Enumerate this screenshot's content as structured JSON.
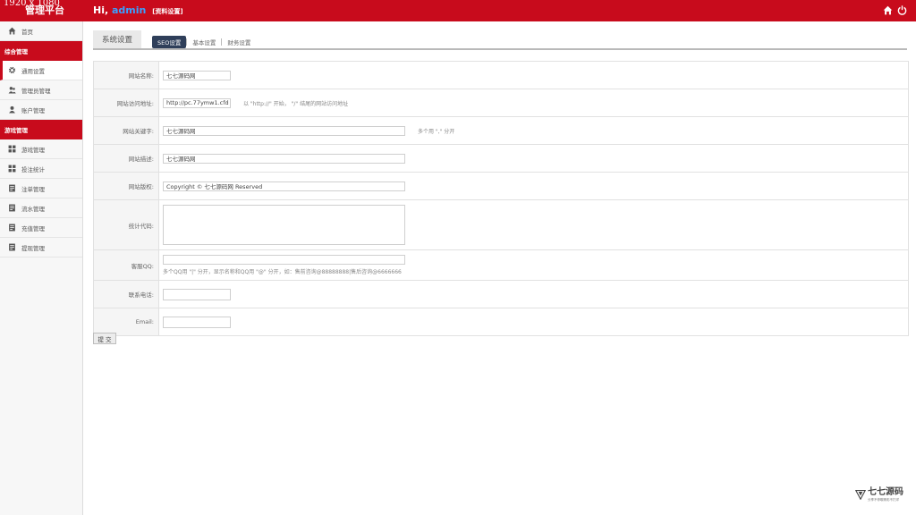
{
  "header": {
    "resolution_text": "1920 x 1080",
    "brand": "管理平台",
    "greeting": "Hi,",
    "username": "admin",
    "profile_link": "[资料设置]",
    "bg_color": "#c80b1c",
    "icons": [
      "home-icon",
      "power-icon"
    ]
  },
  "sidebar": {
    "items": [
      {
        "type": "item",
        "label": "首页",
        "icon": "home-icon",
        "active": false
      },
      {
        "type": "group",
        "label": "综合管理"
      },
      {
        "type": "item",
        "label": "通用设置",
        "icon": "gear-icon",
        "active": true
      },
      {
        "type": "item",
        "label": "管理员管理",
        "icon": "users-icon",
        "active": false
      },
      {
        "type": "item",
        "label": "账户管理",
        "icon": "user-icon",
        "active": false
      },
      {
        "type": "group",
        "label": "游戏管理"
      },
      {
        "type": "item",
        "label": "游戏管理",
        "icon": "grid-icon",
        "active": false
      },
      {
        "type": "item",
        "label": "投注统计",
        "icon": "grid-icon",
        "active": false
      },
      {
        "type": "item",
        "label": "注单管理",
        "icon": "doc-icon",
        "active": false
      },
      {
        "type": "item",
        "label": "流水管理",
        "icon": "doc-icon",
        "active": false
      },
      {
        "type": "item",
        "label": "充值管理",
        "icon": "doc-icon",
        "active": false
      },
      {
        "type": "item",
        "label": "提现管理",
        "icon": "doc-icon",
        "active": false
      }
    ]
  },
  "main": {
    "title": "系统设置",
    "subtabs": [
      "SEO设置",
      "基本设置",
      "财务设置"
    ],
    "active_subtab": "SEO设置",
    "form": {
      "site_name": {
        "label": "网站名称:",
        "value": "七七源码网"
      },
      "site_url": {
        "label": "网站访问地址:",
        "value": "http://pc.77ymw1.cfd",
        "hint": "以 \"http://\" 开始， \"/\" 结尾的网站访问地址"
      },
      "keywords": {
        "label": "网站关键字:",
        "value": "七七源码网",
        "hint": "多个用 \",\" 分开"
      },
      "description": {
        "label": "网站描述:",
        "value": "七七源码网"
      },
      "copyright": {
        "label": "网站版权:",
        "value": "Copyright © 七七源码网 Reserved"
      },
      "stats_code": {
        "label": "统计代码:",
        "value": ""
      },
      "service_qq": {
        "label": "客服QQ:",
        "value": "",
        "hint": "多个QQ用 \"|\" 分开，显示名称和QQ用 \"@\" 分开，如：售前咨询@88888888|售后咨询@6666666"
      },
      "phone": {
        "label": "联系电话:",
        "value": ""
      },
      "email": {
        "label": "Email:",
        "value": ""
      }
    },
    "submit_label": "提 交"
  },
  "watermark": {
    "title": "七七源码",
    "subtitle": "分享不停歇精彩不打烊",
    "icon": "v-logo-icon"
  }
}
